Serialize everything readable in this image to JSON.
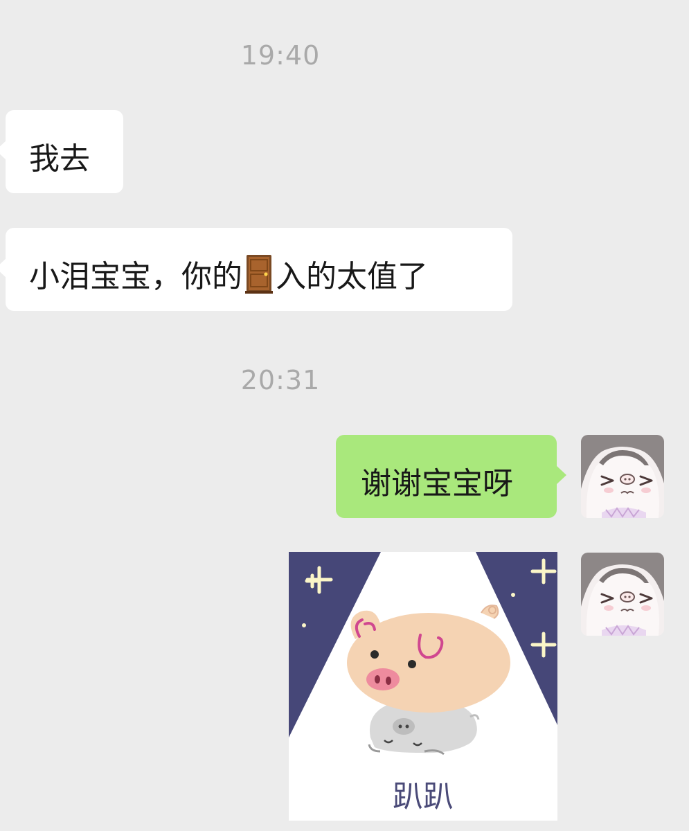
{
  "conversation": {
    "messages": [
      {
        "type": "timestamp",
        "text": "19:40"
      },
      {
        "type": "text",
        "direction": "incoming",
        "text": "我去"
      },
      {
        "type": "text",
        "direction": "incoming",
        "text_before_emoji": "小泪宝宝，你的",
        "emoji": "door-emoji",
        "text_after_emoji": "入的太值了"
      },
      {
        "type": "timestamp",
        "text": "20:31"
      },
      {
        "type": "text",
        "direction": "outgoing",
        "text": "谢谢宝宝呀"
      },
      {
        "type": "sticker",
        "direction": "outgoing",
        "sticker": "lying-pig-sticker",
        "caption": "趴趴"
      }
    ]
  },
  "avatars": {
    "self": "anime-girl-avatar"
  },
  "colors": {
    "background": "#ececec",
    "incoming_bubble": "#ffffff",
    "outgoing_bubble": "#a9e87c",
    "timestamp_text": "#a9a9a9",
    "sticker_night_sky": "#464778",
    "sticker_star": "#fbf6c8",
    "pig_body": "#f5d3b3",
    "pig_accent": "#d0478f",
    "caption_text": "#4a4a78"
  }
}
